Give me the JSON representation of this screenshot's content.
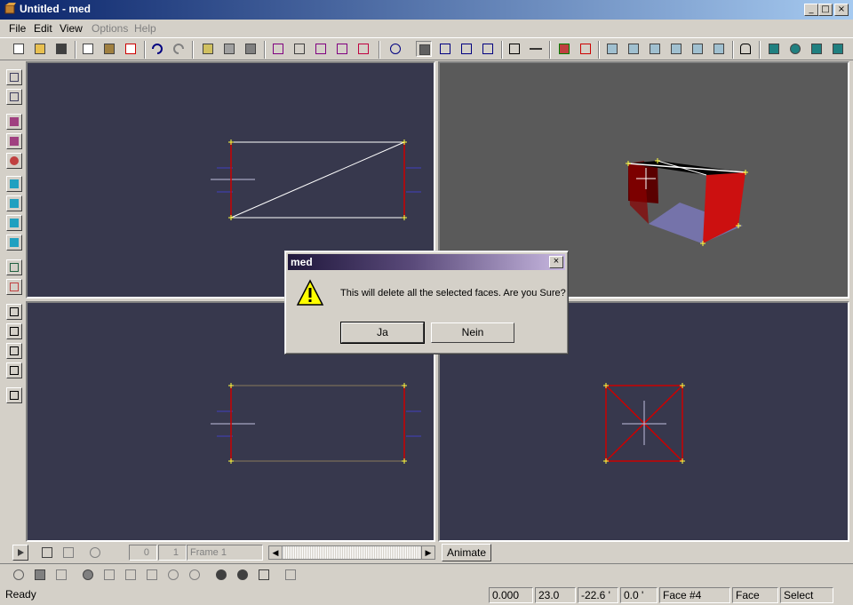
{
  "window": {
    "title": "Untitled - med"
  },
  "menu": [
    {
      "label": "File",
      "enabled": true
    },
    {
      "label": "Edit",
      "enabled": true
    },
    {
      "label": "View",
      "enabled": true
    },
    {
      "label": "Options",
      "enabled": false
    },
    {
      "label": "Help",
      "enabled": false
    }
  ],
  "dialog": {
    "title": "med",
    "message": "This will delete all the selected faces. Are you Sure?",
    "yes_label": "Ja",
    "no_label": "Nein"
  },
  "anim": {
    "start": "0",
    "end": "1",
    "frame": "Frame 1",
    "animate_label": "Animate"
  },
  "status": {
    "ready": "Ready",
    "f1": "0.000",
    "f2": "23.0",
    "f3": "-22.6 '",
    "f4": "0.0 '",
    "face": "Face #4",
    "mode": "Face",
    "tool": "Select"
  },
  "colors": {
    "viewport_bg": "#37384d",
    "perspective_bg": "#5a5a5a",
    "accent_red": "#cc0000",
    "title_blue": "#0a246a"
  }
}
